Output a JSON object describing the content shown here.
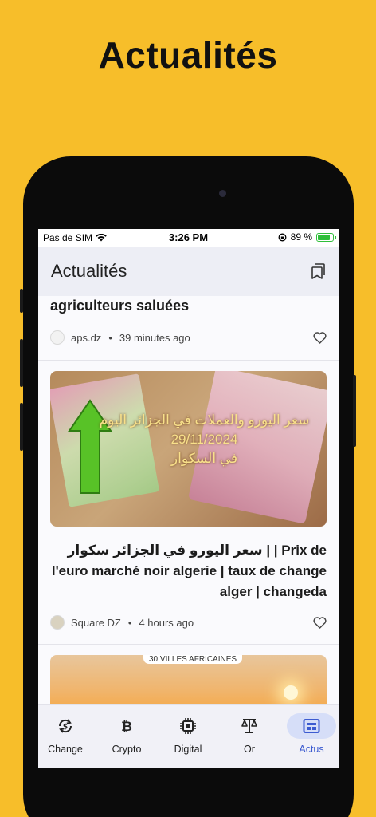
{
  "promo": {
    "title": "Actualités"
  },
  "status_bar": {
    "carrier": "Pas de SIM",
    "time": "3:26 PM",
    "battery": "89 %"
  },
  "app_bar": {
    "title": "Actualités",
    "action_icon": "bookmarks-icon"
  },
  "feed": {
    "previous_article": {
      "title_tail": "agriculteurs saluées",
      "source": "aps.dz",
      "time": "39 minutes ago"
    },
    "article": {
      "image_text_line1": "سعر اليورو والعملات في الجزائر اليوم",
      "image_text_line2": "29/11/2024",
      "image_text_line3": "في السكوار",
      "title": "سعر اليورو في الجزائر سكوار | | Prix de l'euro marché noir algerie | taux de change alger | changeda",
      "source": "Square DZ",
      "time": "4 hours ago"
    },
    "next_article": {
      "image_label": "30 VILLES AFRICAINES"
    }
  },
  "bottom_nav": {
    "items": [
      {
        "label": "Change",
        "icon": "currency-exchange-icon"
      },
      {
        "label": "Crypto",
        "icon": "bitcoin-icon"
      },
      {
        "label": "Digital",
        "icon": "chip-icon"
      },
      {
        "label": "Or",
        "icon": "gold-scale-icon"
      },
      {
        "label": "Actus",
        "icon": "news-icon"
      }
    ],
    "active": "Actus"
  },
  "colors": {
    "background": "#F7BE2A",
    "accent": "#3C5BD0",
    "active_pill": "#D6DEF8"
  }
}
